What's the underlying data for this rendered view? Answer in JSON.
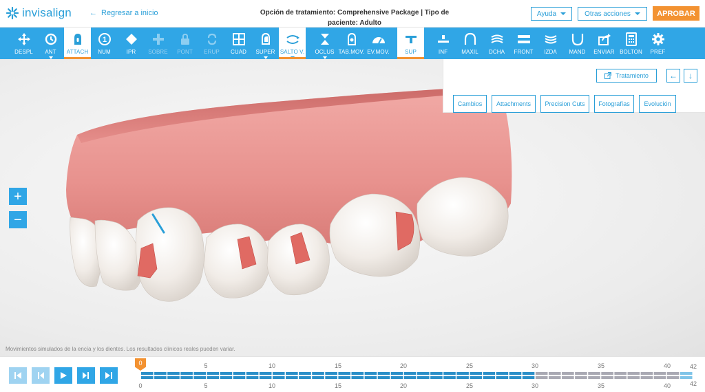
{
  "header": {
    "logo_text": "invisalign",
    "back_label": "Regresar a inicio",
    "title": "Opción de tratamiento: Comprehensive Package | Tipo de paciente: Adulto",
    "help_label": "Ayuda",
    "other_actions_label": "Otras acciones",
    "approve_label": "APROBAR"
  },
  "toolbar": {
    "items": [
      {
        "label": "DESPL",
        "icon": "move-icon"
      },
      {
        "label": "ANT",
        "icon": "rotate-icon"
      },
      {
        "label": "ATTACH",
        "icon": "attachment-icon"
      },
      {
        "label": "NUM",
        "icon": "number-icon"
      },
      {
        "label": "IPR",
        "icon": "ipr-icon"
      },
      {
        "label": "SOBRE",
        "icon": "overcorrection-icon"
      },
      {
        "label": "PONT",
        "icon": "pontic-icon"
      },
      {
        "label": "ERUP",
        "icon": "eruption-icon"
      },
      {
        "label": "CUAD",
        "icon": "grid-icon"
      },
      {
        "label": "SUPER",
        "icon": "superimpose-icon"
      },
      {
        "label": "SALTO V.",
        "icon": "jump-icon"
      },
      {
        "label": "OCLUS",
        "icon": "occlusion-icon"
      },
      {
        "label": "TAB.MOV.",
        "icon": "movement-table-icon"
      },
      {
        "label": "EV.MOV.",
        "icon": "movement-assessment-icon"
      },
      {
        "label": "SUP",
        "icon": "upper-arch-icon"
      },
      {
        "label": "INF",
        "icon": "lower-arch-icon"
      },
      {
        "label": "MAXIL",
        "icon": "maxillary-icon"
      },
      {
        "label": "DCHA",
        "icon": "right-view-icon"
      },
      {
        "label": "FRONT",
        "icon": "front-view-icon"
      },
      {
        "label": "IZDA",
        "icon": "left-view-icon"
      },
      {
        "label": "MAND",
        "icon": "mandibular-icon"
      },
      {
        "label": "ENVIAR",
        "icon": "share-icon"
      },
      {
        "label": "BOLTON",
        "icon": "calculator-icon"
      },
      {
        "label": "PREF",
        "icon": "gear-icon"
      }
    ]
  },
  "panel": {
    "treatment_label": "Tratamiento",
    "tabs": [
      "Cambios",
      "Attachments",
      "Precision Cuts",
      "Fotografías",
      "Evolución"
    ]
  },
  "viewport": {
    "zoom_in": "+",
    "zoom_out": "−",
    "disclaimer": "Movimientos simulados de la encía y los dientes. Los resultados clínicos reales pueden variar."
  },
  "timeline": {
    "current_stage": "0",
    "ticks": [
      "0",
      "5",
      "10",
      "15",
      "20",
      "25",
      "30",
      "35",
      "40"
    ],
    "total_top": "42",
    "total_bottom": "42",
    "progress_stage": 30
  },
  "colors": {
    "accent": "#30a6e6",
    "approve": "#f39231",
    "gum": "#e8928e",
    "attachment": "#e06a63"
  }
}
